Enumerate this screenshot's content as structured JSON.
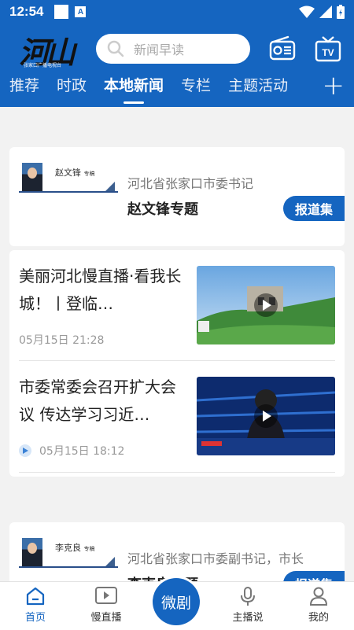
{
  "status_bar": {
    "time": "12:54"
  },
  "header": {
    "logo_text": "河山",
    "logo_sub": "张家口广播电视台",
    "search_placeholder": "新闻早读"
  },
  "tabs": [
    {
      "label": "推荐"
    },
    {
      "label": "时政"
    },
    {
      "label": "本地新闻",
      "active": true
    },
    {
      "label": "专栏"
    },
    {
      "label": "主题活动"
    }
  ],
  "specials": [
    {
      "image_name": "赵文锋",
      "image_tag": "专稿",
      "subtitle": "河北省张家口市委书记",
      "title": "赵文锋专题",
      "button": "报道集"
    },
    {
      "image_name": "李克良",
      "image_tag": "专稿",
      "subtitle": "河北省张家口市委副书记，市长",
      "title": "李克良专题",
      "button": "报道集"
    }
  ],
  "news": [
    {
      "title": "美丽河北慢直播·看我长城！丨登临…",
      "time": "05月15日 21:28"
    },
    {
      "title": "市委常委会召开扩大会议 传达学习习近…",
      "time": "05月15日 18:12"
    }
  ],
  "bottom_nav": {
    "home": "首页",
    "live": "慢直播",
    "center": "微剧",
    "anchor": "主播说",
    "mine": "我的"
  },
  "colors": {
    "brand": "#1565c0"
  }
}
